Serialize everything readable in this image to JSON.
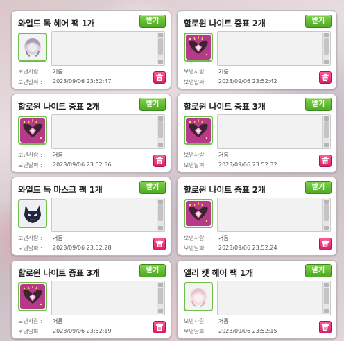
{
  "labels": {
    "receive": "받기",
    "sender": "보낸사람 :",
    "date": "보낸날짜 :"
  },
  "icons": {
    "pink_ear_hair": "pink-ear-hair-icon",
    "halloween_knight_emblem": "halloween-knight-emblem-icon",
    "wild_dog_mask": "wild-dog-mask-icon",
    "delete": "trash-icon"
  },
  "cards": [
    {
      "title": "와일드 독 헤어 팩 1개",
      "sender": "거름",
      "date": "2023/09/06 23:52:47",
      "icon": "wild-dog-hair-icon"
    },
    {
      "title": "할로윈 나이트 증표 2개",
      "sender": "거름",
      "date": "2023/09/06 23:52:42",
      "icon": "halloween-knight-emblem-icon"
    },
    {
      "title": "할로윈 나이트 증표 2개",
      "sender": "거름",
      "date": "2023/09/06 23:52:36",
      "icon": "halloween-knight-emblem-icon"
    },
    {
      "title": "할로윈 나이트 증표 3개",
      "sender": "거름",
      "date": "2023/09/06 23:52:32",
      "icon": "halloween-knight-emblem-icon"
    },
    {
      "title": "와일드 독 마스크 팩 1개",
      "sender": "거름",
      "date": "2023/09/06 23:52:28",
      "icon": "wild-dog-mask-icon"
    },
    {
      "title": "할로윈 나이트 증표 2개",
      "sender": "거름",
      "date": "2023/09/06 23:52:24",
      "icon": "halloween-knight-emblem-icon"
    },
    {
      "title": "할로윈 나이트 증표 3개",
      "sender": "거름",
      "date": "2023/09/06 23:52:19",
      "icon": "halloween-knight-emblem-icon"
    },
    {
      "title": "앨리 캣 헤어 팩 1개",
      "sender": "거름",
      "date": "2023/09/06 23:52:15",
      "icon": "ally-cat-hair-icon"
    }
  ]
}
